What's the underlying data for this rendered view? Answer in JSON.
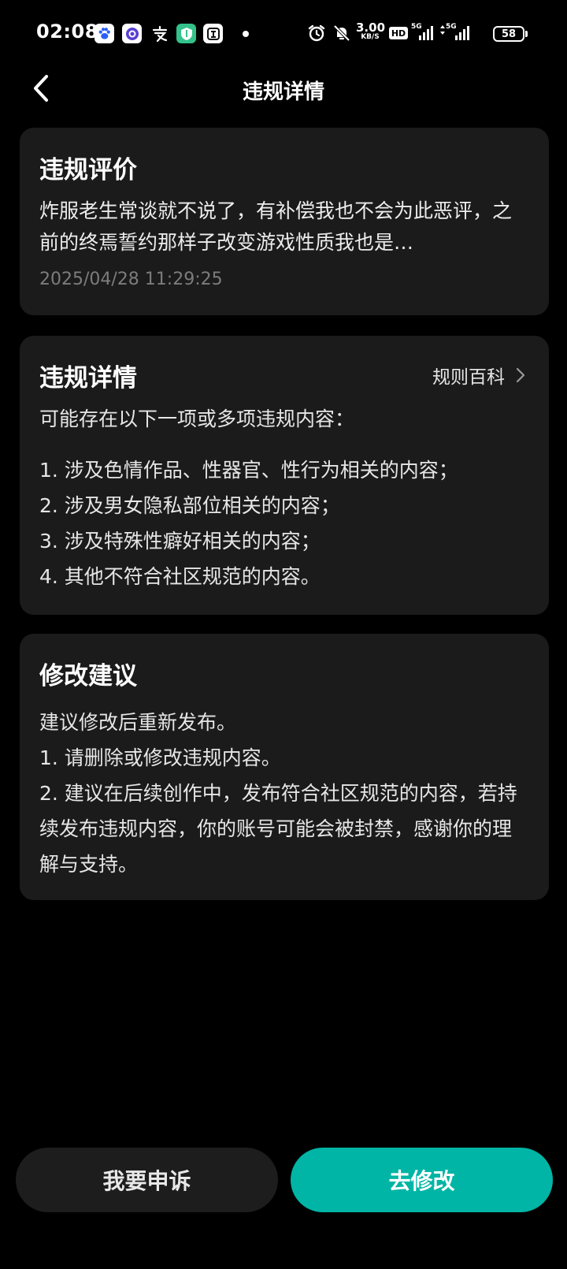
{
  "status_bar": {
    "time": "02:08",
    "app_icons": [
      {
        "name": "baidu-paw-icon",
        "glyph": "🐾",
        "bg": "#ffffff",
        "fg": "#2b5ff5"
      },
      {
        "name": "circle-app-icon",
        "glyph": "◉",
        "bg": "#ffffff",
        "fg": "#5a3fd6"
      },
      {
        "name": "alipay-icon",
        "glyph": "支",
        "bg": "transparent",
        "fg": "#ffffff"
      },
      {
        "name": "shield-app-icon",
        "glyph": "⛉",
        "bg": "#33c28a",
        "fg": "#ffffff"
      },
      {
        "name": "tieba-icon",
        "glyph": "贴",
        "bg": "#ffffff",
        "fg": "#111111"
      }
    ],
    "net_speed": "3.00",
    "net_speed_unit": "KB/S",
    "hd_label": "HD",
    "signal_1_label": "5G",
    "signal_2_label": "5G",
    "battery": "58"
  },
  "header": {
    "title": "违规详情"
  },
  "violation_review": {
    "title": "违规评价",
    "text": "炸服老生常谈就不说了，有补偿我也不会为此恶评，之前的终焉誓约那样子改变游戏性质我也是…",
    "timestamp": "2025/04/28 11:29:25"
  },
  "violation_details": {
    "title": "违规详情",
    "rules_link": "规则百科",
    "intro": "可能存在以下一项或多项违规内容：",
    "items": [
      "1. 涉及色情作品、性器官、性行为相关的内容；",
      "2. 涉及男女隐私部位相关的内容；",
      "3. 涉及特殊性癖好相关的内容；",
      "4. 其他不符合社区规范的内容。"
    ]
  },
  "suggestions": {
    "title": "修改建议",
    "items": [
      "建议修改后重新发布。",
      "1. 请删除或修改违规内容。",
      "2. 建议在后续创作中，发布符合社区规范的内容，若持续发布违规内容，你的账号可能会被封禁，感谢你的理解与支持。"
    ]
  },
  "actions": {
    "appeal_label": "我要申诉",
    "edit_label": "去修改"
  },
  "colors": {
    "background": "#000000",
    "card": "#1b1b1b",
    "accent": "#00b5a5",
    "muted_text": "#7c7c7c"
  }
}
